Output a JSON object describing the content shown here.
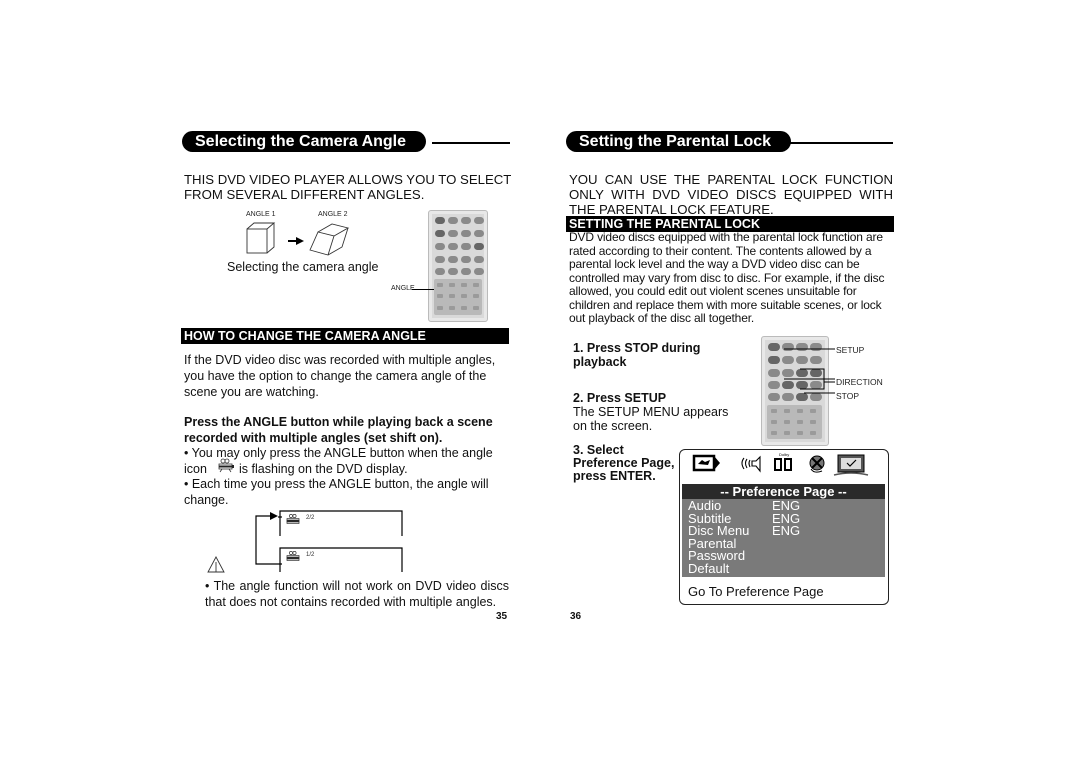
{
  "left_page": {
    "title": "Selecting the Camera Angle",
    "intro": "THIS DVD VIDEO PLAYER ALLOWS YOU TO SELECT FROM SEVERAL DIFFERENT ANGLES.",
    "figure": {
      "angle1_label": "ANGLE 1",
      "angle2_label": "ANGLE 2",
      "caption": "Selecting the camera angle",
      "remote_callout": "ANGLE"
    },
    "section_heading": "HOW TO CHANGE THE CAMERA ANGLE",
    "paragraph": "If the DVD video disc was recorded with multiple angles, you have the option to change the camera angle of the scene you are watching.",
    "instruction": "Press the ANGLE button while playing back a scene recorded with multiple angles (set shift on).",
    "bullet1_line1": "• You may only press the ANGLE button when the angle",
    "bullet1_prefix": "icon",
    "bullet1_suffix": "is flashing on the DVD display.",
    "bullet2": "• Each time you press the ANGLE button, the angle will change.",
    "display_top": "2/2",
    "display_bottom": "1/2",
    "warning": "• The angle function will not work on DVD video discs that does not contains recorded with multiple angles.",
    "page_number": "35"
  },
  "right_page": {
    "title": "Setting the Parental Lock",
    "intro": "YOU CAN USE THE PARENTAL LOCK FUNCTION ONLY WITH DVD VIDEO DISCS EQUIPPED WITH THE PARENTAL LOCK FEATURE.",
    "section_heading": "SETTING THE PARENTAL LOCK",
    "paragraph": "DVD video discs equipped with the parental lock function are rated according to their content. The contents allowed by a parental lock level and the way a DVD video disc can be controlled may vary from disc to disc.  For example, if the disc allowed, you could edit out violent scenes unsuitable for children and replace them with more suitable scenes, or lock out playback of the disc all together.",
    "step1": "1. Press STOP during playback",
    "step2_title": "2. Press SETUP",
    "step2_body": "The SETUP MENU appears on the screen.",
    "step3": "3. Select Preference Page, press ENTER.",
    "remote_callouts": {
      "setup": "SETUP",
      "direction": "DIRECTION",
      "stop": "STOP"
    },
    "menu": {
      "icons": [
        "general-setup-icon",
        "audio-setup-icon",
        "dolby-digital-icon",
        "video-setup-icon",
        "preference-icon"
      ],
      "dolby_label": "Dolby",
      "title": "-- Preference Page --",
      "rows": [
        {
          "label": "Audio",
          "value": "ENG"
        },
        {
          "label": "Subtitle",
          "value": "ENG"
        },
        {
          "label": "Disc Menu",
          "value": "ENG"
        },
        {
          "label": "Parental",
          "value": ""
        },
        {
          "label": "Password",
          "value": ""
        },
        {
          "label": "Default",
          "value": ""
        }
      ],
      "footer": "Go To Preference Page"
    },
    "page_number": "36"
  }
}
